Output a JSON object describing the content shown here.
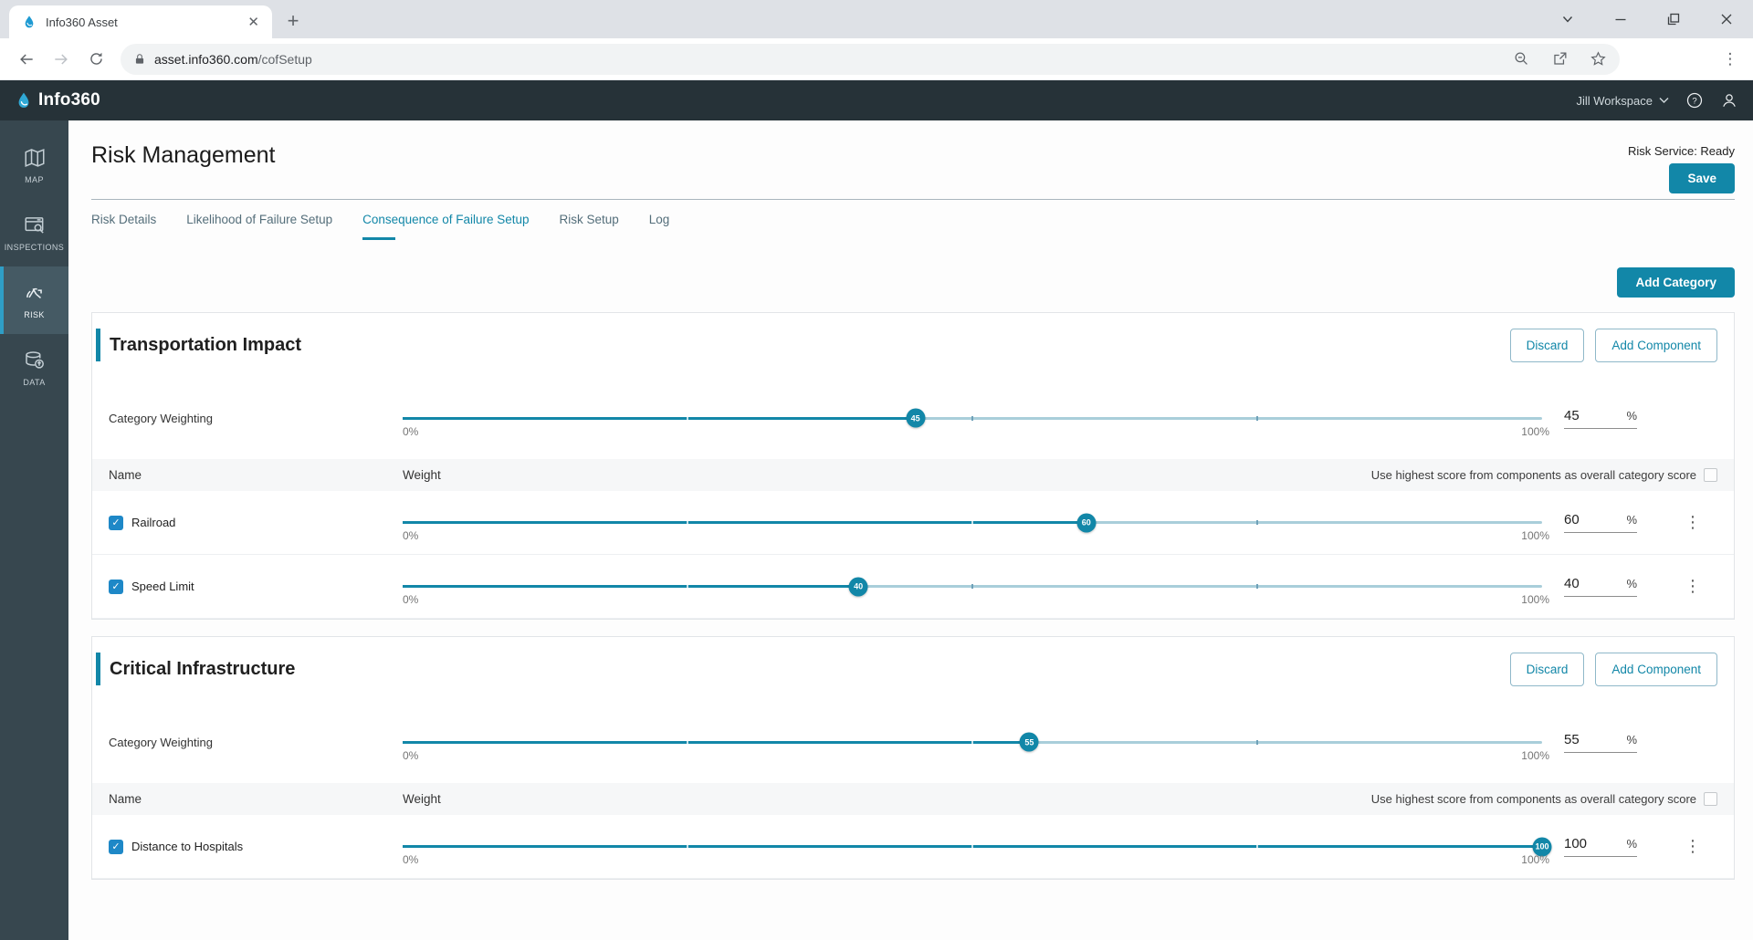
{
  "browser": {
    "tab_title": "Info360 Asset",
    "url_domain": "asset.info360.com",
    "url_path": "/cofSetup"
  },
  "header": {
    "logo_text": "Info360",
    "workspace": "Jill Workspace"
  },
  "sidebar": {
    "items": [
      {
        "label": "MAP",
        "active": false
      },
      {
        "label": "INSPECTIONS",
        "active": false
      },
      {
        "label": "RISK",
        "active": true
      },
      {
        "label": "DATA",
        "active": false
      }
    ]
  },
  "page": {
    "title": "Risk Management",
    "service_status": "Risk Service: Ready",
    "save_label": "Save",
    "add_category_label": "Add Category",
    "tabs": [
      {
        "label": "Risk Details",
        "active": false
      },
      {
        "label": "Likelihood of Failure Setup",
        "active": false
      },
      {
        "label": "Consequence of Failure Setup",
        "active": true
      },
      {
        "label": "Risk Setup",
        "active": false
      },
      {
        "label": "Log",
        "active": false
      }
    ]
  },
  "labels": {
    "category_weighting": "Category Weighting",
    "name_col": "Name",
    "weight_col": "Weight",
    "highest_score": "Use highest score from components as overall category score",
    "discard": "Discard",
    "add_component": "Add Component",
    "min": "0%",
    "max": "100%",
    "percent": "%"
  },
  "categories": [
    {
      "name": "Transportation Impact",
      "weighting": 45,
      "components": [
        {
          "name": "Railroad",
          "weight": 60,
          "checked": true
        },
        {
          "name": "Speed Limit",
          "weight": 40,
          "checked": true
        }
      ]
    },
    {
      "name": "Critical Infrastructure",
      "weighting": 55,
      "components": [
        {
          "name": "Distance to Hospitals",
          "weight": 100,
          "checked": true
        }
      ]
    }
  ],
  "colors": {
    "accent": "#1287A8",
    "header_bg": "#263238",
    "sidebar_bg": "#37474F",
    "sidebar_active_bg": "#455A64",
    "sidebar_active_border": "#2F9EC6",
    "checkbox_blue": "#1E88C7",
    "slider_track": "#A9CEDA"
  }
}
